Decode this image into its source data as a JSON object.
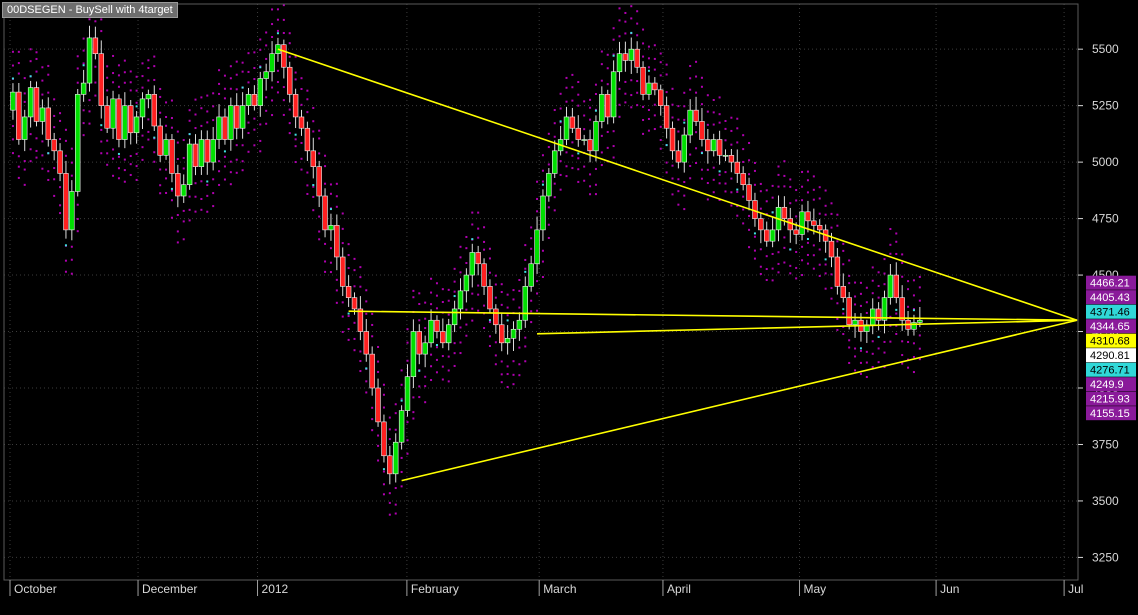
{
  "title": "00DSEGEN - BuySell with 4target",
  "colors": {
    "background": "#000000",
    "up_candle": "#00e000",
    "down_candle": "#ff2020",
    "trendline": "#ffff00",
    "dots": "#b000b0",
    "cyan_dots": "#40e0e0",
    "level_purple": "#8a1a9a",
    "level_cyan": "#30d8d8",
    "level_yellow": "#ffff00",
    "level_white": "#ffffff"
  },
  "chart_data": {
    "type": "candlestick",
    "title": "00DSEGEN - BuySell with 4target",
    "xlabel": "",
    "ylabel": "",
    "ylim": [
      3150,
      5700
    ],
    "y_ticks": [
      3250,
      3500,
      3750,
      4000,
      4250,
      4500,
      4750,
      5000,
      5250,
      5500
    ],
    "x_ticks": [
      "October",
      "December",
      "2012",
      "February",
      "March",
      "April",
      "May",
      "Jun",
      "Jul"
    ],
    "bars": 180,
    "series": [
      {
        "close": [
          5310,
          5100,
          5200,
          5330,
          5180,
          5240,
          5100,
          5050,
          4950,
          4700,
          4870,
          5300,
          5350,
          5550,
          5480,
          5250,
          5150,
          5280,
          5100,
          5250,
          5130,
          5200,
          5280,
          5300,
          5160,
          5030,
          5100,
          4950,
          4850,
          4900,
          5080,
          4980,
          5100,
          5000,
          5100,
          5200,
          5100,
          5250,
          5150,
          5250,
          5300,
          5250,
          5370,
          5400,
          5480,
          5520,
          5420,
          5300,
          5200,
          5150,
          5050,
          4980,
          4850,
          4700,
          4720,
          4580,
          4450,
          4400,
          4350,
          4250,
          4150,
          4000,
          3850,
          3700,
          3620,
          3760,
          3900,
          4050,
          4250,
          4150,
          4200,
          4300,
          4250,
          4200,
          4280,
          4350,
          4430,
          4500,
          4600,
          4550,
          4450,
          4350,
          4280,
          4200,
          4220,
          4260,
          4300,
          4450,
          4550,
          4700,
          4850,
          4950,
          5050,
          5100,
          5200,
          5150,
          5100,
          5100,
          5050,
          5180,
          5300,
          5200,
          5400,
          5480,
          5450,
          5500,
          5420,
          5300,
          5350,
          5320,
          5250,
          5150,
          5050,
          5000,
          5120,
          5230,
          5180,
          5100,
          5050,
          5100,
          5030,
          5030,
          5000,
          4950,
          4900,
          4830,
          4750,
          4700,
          4650,
          4700,
          4800,
          4750,
          4700,
          4680,
          4780,
          4740,
          4720,
          4700,
          4650,
          4580,
          4450,
          4400,
          4280,
          4300,
          4250,
          4280,
          4350,
          4300,
          4400,
          4500,
          4400,
          4300,
          4260,
          4290,
          4300
        ]
      }
    ],
    "trendlines": [
      {
        "from": [
          45,
          5500
        ],
        "to": [
          179,
          4300
        ]
      },
      {
        "from": [
          57,
          4340
        ],
        "to": [
          179,
          4300
        ]
      },
      {
        "from": [
          66,
          3590
        ],
        "to": [
          179,
          4300
        ]
      },
      {
        "from": [
          89,
          4240
        ],
        "to": [
          179,
          4300
        ]
      }
    ],
    "levels": [
      {
        "label": "4466.21",
        "value": 4466.21,
        "style": "purple"
      },
      {
        "label": "4405.43",
        "value": 4405.43,
        "style": "purple"
      },
      {
        "label": "4371.46",
        "value": 4371.46,
        "style": "cyan"
      },
      {
        "label": "4344.65",
        "value": 4344.65,
        "style": "purple"
      },
      {
        "label": "4310.68",
        "value": 4310.68,
        "style": "yellow"
      },
      {
        "label": "4290.81",
        "value": 4290.81,
        "style": "white"
      },
      {
        "label": "4276.71",
        "value": 4276.71,
        "style": "cyan"
      },
      {
        "label": "4249.9",
        "value": 4249.9,
        "style": "purple"
      },
      {
        "label": "4215.93",
        "value": 4215.93,
        "style": "purple"
      },
      {
        "label": "4155.15",
        "value": 4155.15,
        "style": "purple"
      }
    ],
    "grid": true
  }
}
